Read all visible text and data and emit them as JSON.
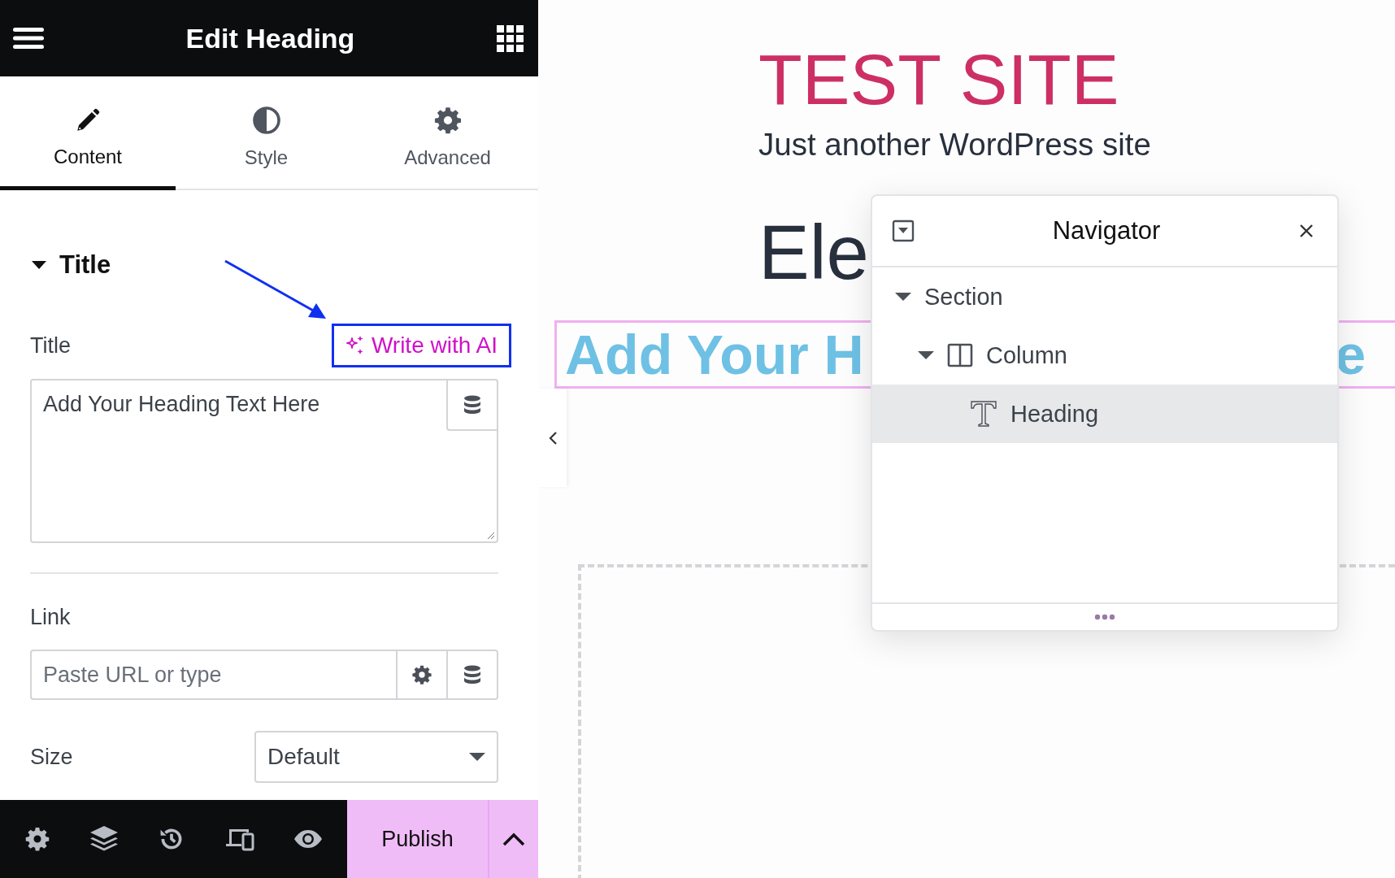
{
  "panel": {
    "title": "Edit Heading",
    "tabs": [
      {
        "label": "Content",
        "kind": "pencil",
        "selected": true
      },
      {
        "label": "Style",
        "kind": "contrast",
        "selected": false
      },
      {
        "label": "Advanced",
        "kind": "gear",
        "selected": false
      }
    ],
    "section": {
      "title": "Title",
      "expanded": true
    },
    "title_field": {
      "label": "Title",
      "ai_button": "Write with AI",
      "value": "Add Your Heading Text Here"
    },
    "link_field": {
      "label": "Link",
      "placeholder": "Paste URL or type"
    },
    "size_field": {
      "label": "Size",
      "value": "Default"
    },
    "publish_button": "Publish"
  },
  "canvas": {
    "site_title": "TEST SITE",
    "tagline": "Just another WordPress site",
    "page_title": "Ele",
    "heading_left": "Add Your H",
    "heading_right": "e"
  },
  "navigator": {
    "title": "Navigator",
    "items": [
      {
        "label": "Section",
        "kind": "section",
        "expanded": true,
        "selected": false,
        "children": [
          {
            "label": "Column",
            "kind": "column",
            "expanded": true,
            "selected": false,
            "children": [
              {
                "label": "Heading",
                "kind": "heading",
                "selected": true
              }
            ]
          }
        ]
      }
    ]
  }
}
